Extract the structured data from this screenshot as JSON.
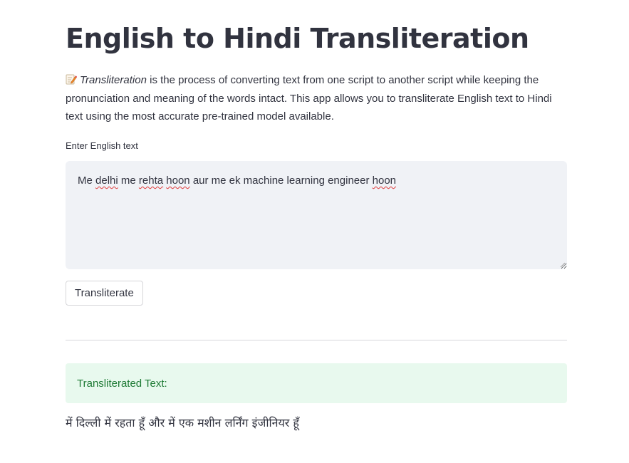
{
  "page": {
    "title": "English to Hindi Transliteration",
    "description": {
      "icon": "memo-icon",
      "emphasis": "Transliteration",
      "rest": " is the process of converting text from one script to another script while keeping the pronunciation and meaning of the words intact. This app allows you to transliterate English text to Hindi text using the most accurate pre-trained model available."
    }
  },
  "input": {
    "label": "Enter English text",
    "value_parts": [
      {
        "text": "Me ",
        "misspelled": false
      },
      {
        "text": "delhi",
        "misspelled": true
      },
      {
        "text": " me ",
        "misspelled": false
      },
      {
        "text": "rehta",
        "misspelled": true
      },
      {
        "text": " ",
        "misspelled": false
      },
      {
        "text": "hoon",
        "misspelled": true
      },
      {
        "text": " aur me ek machine learning engineer ",
        "misspelled": false
      },
      {
        "text": "hoon",
        "misspelled": true
      }
    ]
  },
  "button": {
    "label": "Transliterate"
  },
  "result": {
    "banner": "Transliterated Text:",
    "output": "में दिल्ली में रहता हूँ और में एक मशीन लर्निंग इंजीनियर हूँ"
  },
  "colors": {
    "text": "#31333f",
    "input_bg": "#f0f2f6",
    "success_bg": "#e8f9ee",
    "success_text": "#1d7a34",
    "spell_underline": "#e03a3a"
  }
}
